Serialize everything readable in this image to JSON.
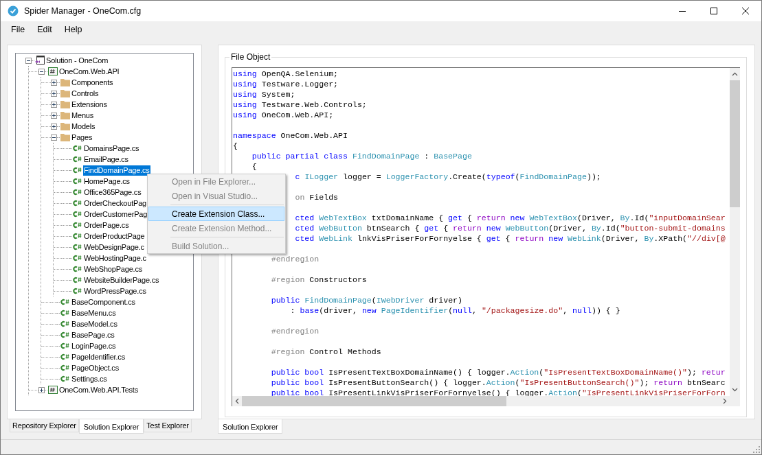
{
  "window": {
    "title": "Spider Manager - OneCom.cfg"
  },
  "menu_bar": [
    {
      "label": "File"
    },
    {
      "label": "Edit"
    },
    {
      "label": "Help"
    }
  ],
  "tree": [
    {
      "label": "Solution - OneCom",
      "kind": "solution",
      "expanded": true,
      "selected": false,
      "children": [
        {
          "label": "OneCom.Web.API",
          "kind": "project",
          "expanded": true,
          "selected": false,
          "children": [
            {
              "label": "Components",
              "kind": "folder",
              "expanded": false,
              "selected": false
            },
            {
              "label": "Controls",
              "kind": "folder",
              "expanded": false,
              "selected": false
            },
            {
              "label": "Extensions",
              "kind": "folder",
              "expanded": false,
              "selected": false
            },
            {
              "label": "Menus",
              "kind": "folder",
              "expanded": false,
              "selected": false
            },
            {
              "label": "Models",
              "kind": "folder",
              "expanded": false,
              "selected": false
            },
            {
              "label": "Pages",
              "kind": "folder",
              "expanded": true,
              "selected": false,
              "children": [
                {
                  "label": "DomainsPage.cs",
                  "kind": "file",
                  "selected": false
                },
                {
                  "label": "EmailPage.cs",
                  "kind": "file",
                  "selected": false
                },
                {
                  "label": "FindDomainPage.cs",
                  "kind": "file",
                  "selected": true
                },
                {
                  "label": "HomePage.cs",
                  "kind": "file",
                  "selected": false
                },
                {
                  "label": "Office365Page.cs",
                  "kind": "file",
                  "selected": false
                },
                {
                  "label": "OrderCheckoutPag",
                  "kind": "file",
                  "selected": false
                },
                {
                  "label": "OrderCustomerPag",
                  "kind": "file",
                  "selected": false
                },
                {
                  "label": "OrderPage.cs",
                  "kind": "file",
                  "selected": false
                },
                {
                  "label": "OrderProductPage",
                  "kind": "file",
                  "selected": false
                },
                {
                  "label": "WebDesignPage.c",
                  "kind": "file",
                  "selected": false
                },
                {
                  "label": "WebHostingPage.c",
                  "kind": "file",
                  "selected": false
                },
                {
                  "label": "WebShopPage.cs",
                  "kind": "file",
                  "selected": false
                },
                {
                  "label": "WebsiteBuilderPage.cs",
                  "kind": "file",
                  "selected": false
                },
                {
                  "label": "WordPressPage.cs",
                  "kind": "file",
                  "selected": false
                }
              ]
            },
            {
              "label": "BaseComponent.cs",
              "kind": "file",
              "selected": false
            },
            {
              "label": "BaseMenu.cs",
              "kind": "file",
              "selected": false
            },
            {
              "label": "BaseModel.cs",
              "kind": "file",
              "selected": false
            },
            {
              "label": "BasePage.cs",
              "kind": "file",
              "selected": false
            },
            {
              "label": "LoginPage.cs",
              "kind": "file",
              "selected": false
            },
            {
              "label": "PageIdentifier.cs",
              "kind": "file",
              "selected": false
            },
            {
              "label": "PageObject.cs",
              "kind": "file",
              "selected": false
            },
            {
              "label": "Settings.cs",
              "kind": "file",
              "selected": false
            }
          ]
        },
        {
          "label": "OneCom.Web.API.Tests",
          "kind": "project",
          "expanded": false,
          "selected": false
        }
      ]
    }
  ],
  "left_tabs": [
    {
      "label": "Repository Explorer",
      "selected": false
    },
    {
      "label": "Solution Explorer",
      "selected": true
    },
    {
      "label": "Test Explorer",
      "selected": false
    }
  ],
  "file_object": {
    "title": "File Object",
    "lines": [
      {
        "kind": "code",
        "tokens": [
          {
            "text": "using",
            "kind": "keyword"
          },
          {
            "text": " OpenQA.Selenium;",
            "kind": "plain"
          }
        ]
      },
      {
        "kind": "code",
        "tokens": [
          {
            "text": "using",
            "kind": "keyword"
          },
          {
            "text": " Testware.Logger;",
            "kind": "plain"
          }
        ]
      },
      {
        "kind": "code",
        "tokens": [
          {
            "text": "using",
            "kind": "keyword"
          },
          {
            "text": " System;",
            "kind": "plain"
          }
        ]
      },
      {
        "kind": "code",
        "tokens": [
          {
            "text": "using",
            "kind": "keyword"
          },
          {
            "text": " Testware.Web.Controls;",
            "kind": "plain"
          }
        ]
      },
      {
        "kind": "code",
        "tokens": [
          {
            "text": "using",
            "kind": "keyword"
          },
          {
            "text": " OneCom.Web.API;",
            "kind": "plain"
          }
        ]
      },
      {
        "kind": "blank"
      },
      {
        "kind": "code",
        "tokens": [
          {
            "text": "namespace",
            "kind": "keyword"
          },
          {
            "text": " OneCom.Web.API",
            "kind": "plain"
          }
        ]
      },
      {
        "kind": "code",
        "tokens": [
          {
            "text": "{",
            "kind": "plain"
          }
        ]
      },
      {
        "kind": "code",
        "tokens": [
          {
            "text": "    public partial class",
            "kind": "keyword"
          },
          {
            "text": " FindDomainPage",
            "kind": "type"
          },
          {
            "text": " : ",
            "kind": "plain"
          },
          {
            "text": "BasePage",
            "kind": "type"
          }
        ]
      },
      {
        "kind": "code",
        "tokens": [
          {
            "text": "    {",
            "kind": "plain"
          }
        ]
      },
      {
        "kind": "code",
        "tokens": [
          {
            "text": "             c",
            "kind": "keyword"
          },
          {
            "text": " ILogger",
            "kind": "type"
          },
          {
            "text": " logger = ",
            "kind": "plain"
          },
          {
            "text": "LoggerFactory",
            "kind": "type"
          },
          {
            "text": ".Create(",
            "kind": "plain"
          },
          {
            "text": "typeof",
            "kind": "keyword"
          },
          {
            "text": "(",
            "kind": "plain"
          },
          {
            "text": "FindDomainPage",
            "kind": "type"
          },
          {
            "text": "));",
            "kind": "plain"
          }
        ]
      },
      {
        "kind": "blank"
      },
      {
        "kind": "code",
        "tokens": [
          {
            "text": "             on",
            "kind": "directive"
          },
          {
            "text": " Fields",
            "kind": "plain"
          }
        ]
      },
      {
        "kind": "blank"
      },
      {
        "kind": "code",
        "tokens": [
          {
            "text": "             cted",
            "kind": "keyword"
          },
          {
            "text": " WebTextBox",
            "kind": "type"
          },
          {
            "text": " txtDomainName { ",
            "kind": "plain"
          },
          {
            "text": "get",
            "kind": "keyword"
          },
          {
            "text": " { ",
            "kind": "plain"
          },
          {
            "text": "return",
            "kind": "control"
          },
          {
            "text": " new",
            "kind": "keyword"
          },
          {
            "text": " WebTextBox",
            "kind": "type"
          },
          {
            "text": "(Driver, ",
            "kind": "plain"
          },
          {
            "text": "By",
            "kind": "type"
          },
          {
            "text": ".Id(",
            "kind": "plain"
          },
          {
            "text": "\"inputDomainSear",
            "kind": "string"
          }
        ]
      },
      {
        "kind": "code",
        "tokens": [
          {
            "text": "             cted",
            "kind": "keyword"
          },
          {
            "text": " WebButton",
            "kind": "type"
          },
          {
            "text": " btnSearch { ",
            "kind": "plain"
          },
          {
            "text": "get",
            "kind": "keyword"
          },
          {
            "text": " { ",
            "kind": "plain"
          },
          {
            "text": "return",
            "kind": "control"
          },
          {
            "text": " new",
            "kind": "keyword"
          },
          {
            "text": " WebButton",
            "kind": "type"
          },
          {
            "text": "(Driver, ",
            "kind": "plain"
          },
          {
            "text": "By",
            "kind": "type"
          },
          {
            "text": ".Id(",
            "kind": "plain"
          },
          {
            "text": "\"button-submit-domains",
            "kind": "string"
          }
        ]
      },
      {
        "kind": "code",
        "tokens": [
          {
            "text": "             cted",
            "kind": "keyword"
          },
          {
            "text": " WebLink",
            "kind": "type"
          },
          {
            "text": " lnkVisPriserForFornyelse { ",
            "kind": "plain"
          },
          {
            "text": "get",
            "kind": "keyword"
          },
          {
            "text": " { ",
            "kind": "plain"
          },
          {
            "text": "return",
            "kind": "control"
          },
          {
            "text": " new",
            "kind": "keyword"
          },
          {
            "text": " WebLink",
            "kind": "type"
          },
          {
            "text": "(Driver, ",
            "kind": "plain"
          },
          {
            "text": "By",
            "kind": "type"
          },
          {
            "text": ".XPath(",
            "kind": "plain"
          },
          {
            "text": "\"//div[@",
            "kind": "string"
          }
        ]
      },
      {
        "kind": "blank"
      },
      {
        "kind": "code",
        "tokens": [
          {
            "text": "        #endregion",
            "kind": "directive"
          }
        ]
      },
      {
        "kind": "blank"
      },
      {
        "kind": "code",
        "tokens": [
          {
            "text": "        #region",
            "kind": "directive"
          },
          {
            "text": " Constructors",
            "kind": "plain"
          }
        ]
      },
      {
        "kind": "blank"
      },
      {
        "kind": "code",
        "tokens": [
          {
            "text": "        public",
            "kind": "keyword"
          },
          {
            "text": " FindDomainPage",
            "kind": "type"
          },
          {
            "text": "(",
            "kind": "plain"
          },
          {
            "text": "IWebDriver",
            "kind": "type"
          },
          {
            "text": " driver)",
            "kind": "plain"
          }
        ]
      },
      {
        "kind": "code",
        "tokens": [
          {
            "text": "            : ",
            "kind": "plain"
          },
          {
            "text": "base",
            "kind": "keyword"
          },
          {
            "text": "(driver, ",
            "kind": "plain"
          },
          {
            "text": "new",
            "kind": "keyword"
          },
          {
            "text": " PageIdentifier",
            "kind": "type"
          },
          {
            "text": "(",
            "kind": "plain"
          },
          {
            "text": "null",
            "kind": "keyword"
          },
          {
            "text": ", ",
            "kind": "plain"
          },
          {
            "text": "\"/packagesize.do\"",
            "kind": "string"
          },
          {
            "text": ", ",
            "kind": "plain"
          },
          {
            "text": "null",
            "kind": "keyword"
          },
          {
            "text": ")) { }",
            "kind": "plain"
          }
        ]
      },
      {
        "kind": "blank"
      },
      {
        "kind": "code",
        "tokens": [
          {
            "text": "        #endregion",
            "kind": "directive"
          }
        ]
      },
      {
        "kind": "blank"
      },
      {
        "kind": "code",
        "tokens": [
          {
            "text": "        #region",
            "kind": "directive"
          },
          {
            "text": " Control Methods",
            "kind": "plain"
          }
        ]
      },
      {
        "kind": "blank"
      },
      {
        "kind": "code",
        "tokens": [
          {
            "text": "        public bool",
            "kind": "keyword"
          },
          {
            "text": " IsPresentTextBoxDomainName() { logger.",
            "kind": "plain"
          },
          {
            "text": "Action",
            "kind": "type"
          },
          {
            "text": "(",
            "kind": "plain"
          },
          {
            "text": "\"IsPresentTextBoxDomainName()\"",
            "kind": "string"
          },
          {
            "text": "); ",
            "kind": "plain"
          },
          {
            "text": "retur",
            "kind": "control"
          }
        ]
      },
      {
        "kind": "code",
        "tokens": [
          {
            "text": "        public bool",
            "kind": "keyword"
          },
          {
            "text": " IsPresentButtonSearch() { logger.",
            "kind": "plain"
          },
          {
            "text": "Action",
            "kind": "type"
          },
          {
            "text": "(",
            "kind": "plain"
          },
          {
            "text": "\"IsPresentButtonSearch()\"",
            "kind": "string"
          },
          {
            "text": "); ",
            "kind": "plain"
          },
          {
            "text": "return",
            "kind": "control"
          },
          {
            "text": " btnSearc",
            "kind": "plain"
          }
        ]
      },
      {
        "kind": "code",
        "tokens": [
          {
            "text": "        public bool",
            "kind": "keyword"
          },
          {
            "text": " IsPresentLinkVisPriserForFornyelse() { logger.",
            "kind": "plain"
          },
          {
            "text": "Action",
            "kind": "type"
          },
          {
            "text": "(",
            "kind": "plain"
          },
          {
            "text": "\"IsPresentLinkVisPriserForForn",
            "kind": "string"
          }
        ]
      }
    ]
  },
  "right_tabs": [
    {
      "label": "Solution Explorer",
      "selected": true
    }
  ],
  "context_menu": [
    {
      "kind": "item",
      "label": "Open in File Explorer...",
      "disabled": true,
      "selected": false
    },
    {
      "kind": "item",
      "label": "Open  in Visual Studio...",
      "disabled": true,
      "selected": false
    },
    {
      "kind": "separator"
    },
    {
      "kind": "item",
      "label": "Create Extension Class...",
      "disabled": false,
      "selected": true
    },
    {
      "kind": "item",
      "label": "Create Extension Method...",
      "disabled": true,
      "selected": false
    },
    {
      "kind": "separator"
    },
    {
      "kind": "item",
      "label": "Build Solution...",
      "disabled": true,
      "selected": false
    }
  ]
}
